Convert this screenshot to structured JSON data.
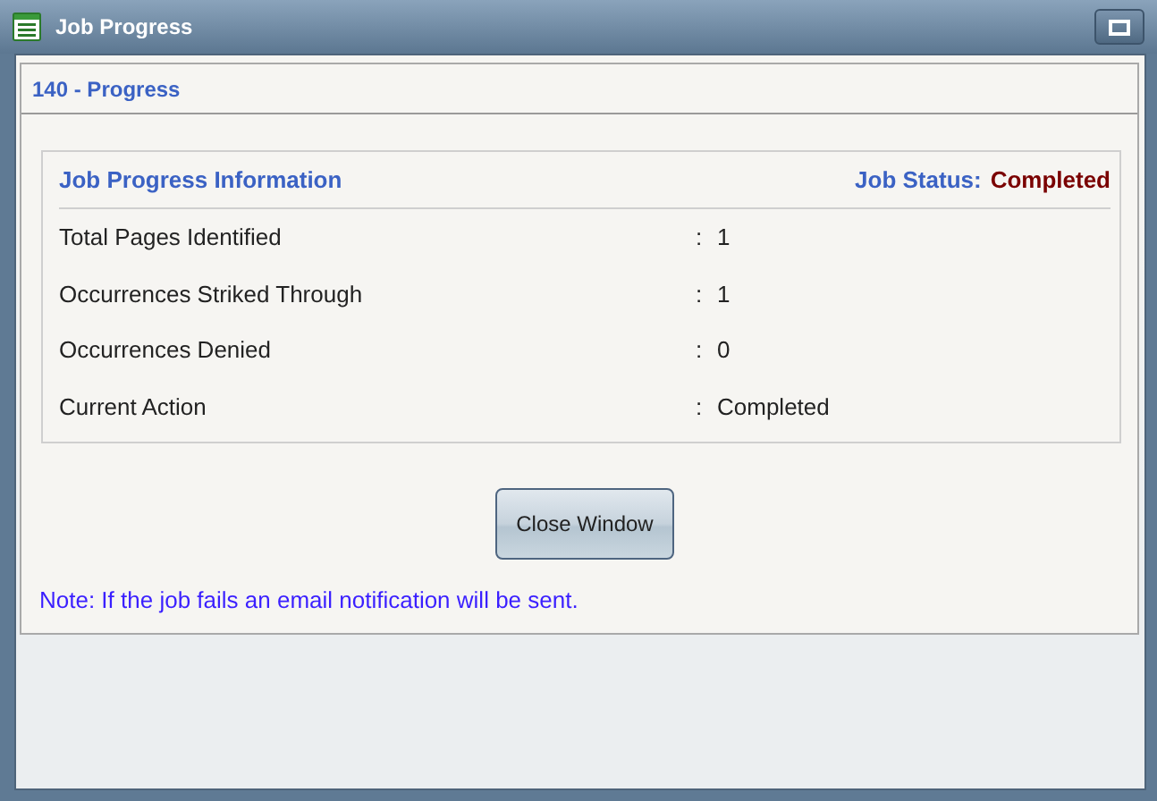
{
  "window": {
    "title": "Job Progress"
  },
  "panel_title": "140 - Progress",
  "info": {
    "title": "Job Progress Information",
    "status_label": "Job Status:",
    "status_value": "Completed",
    "rows": [
      {
        "label": "Total Pages Identified",
        "separator": ":",
        "value": "1"
      },
      {
        "label": "Occurrences Striked Through",
        "separator": ":",
        "value": "1"
      },
      {
        "label": "Occurrences Denied",
        "separator": ":",
        "value": "0"
      },
      {
        "label": "Current Action",
        "separator": ":",
        "value": "Completed"
      }
    ]
  },
  "buttons": [
    "Close Window"
  ],
  "note": "Note: If the job fails an email notification will be sent."
}
